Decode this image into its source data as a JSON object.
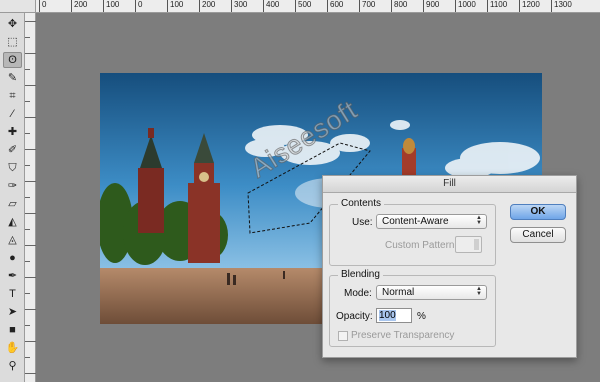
{
  "ruler": {
    "top_ticks": [
      "0",
      "200",
      "100",
      "0",
      "100",
      "200",
      "300",
      "400",
      "500",
      "600",
      "700",
      "800",
      "900",
      "1000",
      "1100",
      "1200",
      "1300"
    ]
  },
  "tools": [
    {
      "name": "move-tool-icon",
      "glyph": "✥"
    },
    {
      "name": "marquee-tool-icon",
      "glyph": "⬚"
    },
    {
      "name": "lasso-tool-icon",
      "glyph": "ʘ",
      "active": true
    },
    {
      "name": "quick-select-tool-icon",
      "glyph": "✎"
    },
    {
      "name": "crop-tool-icon",
      "glyph": "⌗"
    },
    {
      "name": "eyedropper-tool-icon",
      "glyph": "⁄"
    },
    {
      "name": "healing-brush-tool-icon",
      "glyph": "✚"
    },
    {
      "name": "brush-tool-icon",
      "glyph": "✐"
    },
    {
      "name": "clone-stamp-tool-icon",
      "glyph": "⛉"
    },
    {
      "name": "history-brush-tool-icon",
      "glyph": "✑"
    },
    {
      "name": "eraser-tool-icon",
      "glyph": "▱"
    },
    {
      "name": "paint-bucket-tool-icon",
      "glyph": "◭"
    },
    {
      "name": "blur-tool-icon",
      "glyph": "◬"
    },
    {
      "name": "dodge-tool-icon",
      "glyph": "●"
    },
    {
      "name": "pen-tool-icon",
      "glyph": "✒"
    },
    {
      "name": "type-tool-icon",
      "glyph": "T"
    },
    {
      "name": "path-select-tool-icon",
      "glyph": "➤"
    },
    {
      "name": "shape-tool-icon",
      "glyph": "■"
    },
    {
      "name": "hand-tool-icon",
      "glyph": "✋"
    },
    {
      "name": "zoom-tool-icon",
      "glyph": "⚲"
    }
  ],
  "watermark": "Aiseesoft",
  "dialog": {
    "title": "Fill",
    "contents_label": "Contents",
    "use_label": "Use:",
    "use_value": "Content-Aware",
    "custom_pattern_label": "Custom Pattern:",
    "blending_label": "Blending",
    "mode_label": "Mode:",
    "mode_value": "Normal",
    "opacity_label": "Opacity:",
    "opacity_value": "100",
    "opacity_unit": "%",
    "preserve_label": "Preserve Transparency",
    "ok_label": "OK",
    "cancel_label": "Cancel"
  },
  "colors": {
    "sky_top": "#1b5a8a",
    "sky_mid": "#4d9bd0",
    "primary_btn": "#6fa5e8"
  }
}
